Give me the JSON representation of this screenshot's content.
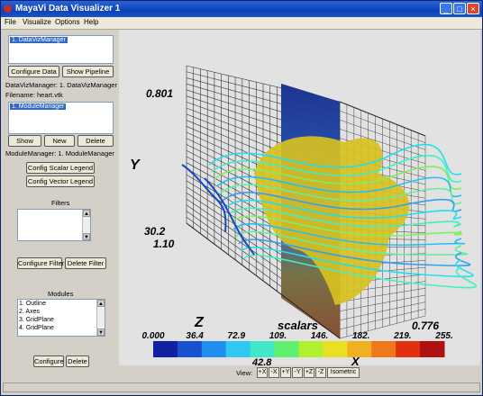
{
  "window": {
    "title": "MayaVi Data Visualizer 1",
    "minimize_glyph": "_",
    "maximize_glyph": "□",
    "close_glyph": "×"
  },
  "menu": [
    "File",
    "Visualize",
    "Options",
    "Help"
  ],
  "data_panel": {
    "list_items": [
      "1. DataVizManager"
    ],
    "configure_label": "Configure Data",
    "pipeline_label": "Show Pipeline",
    "manager_text": "DataVizManager: 1. DataVizManager",
    "filename_text": "Filename: heart.vtk"
  },
  "module_manager_panel": {
    "list_items": [
      "1. ModuleManager"
    ],
    "show_label": "Show",
    "new_label": "New",
    "delete_label": "Delete",
    "manager_text": "ModuleManager: 1. ModuleManager",
    "scalar_legend_label": "Config Scalar Legend",
    "vector_legend_label": "Config Vector Legend"
  },
  "filters_panel": {
    "heading": "Filters",
    "configure_label": "Configure Filter",
    "delete_label": "Delete Filter"
  },
  "modules_panel": {
    "heading": "Modules",
    "items": [
      "1. Outline",
      "2. Axes",
      "3. GridPlane",
      "4. GridPlane"
    ],
    "configure_label": "Configure",
    "delete_label": "Delete"
  },
  "scene": {
    "axis_y_top": "0.801",
    "axis_y_bottom": "30.2",
    "axis_y_low": "1.10",
    "axis_x_right": "0.776",
    "axis_z_bottom": "42.8",
    "y_letter": "Y",
    "z_letter": "Z",
    "x_letter": "X",
    "legend_title": "scalars",
    "legend_ticks": [
      "0.000",
      "36.4",
      "72.9",
      "109.",
      "146.",
      "182.",
      "219.",
      "255."
    ],
    "legend_colors": [
      "#1020a0",
      "#1850d0",
      "#2090f0",
      "#30c8f0",
      "#40e8c8",
      "#60f070",
      "#b0f030",
      "#e8e020",
      "#f0b020",
      "#f07818",
      "#e03010",
      "#b01010"
    ],
    "surface_color": "#d8c020"
  },
  "viewbar": {
    "label": "View:",
    "buttons": [
      "+X",
      "-X",
      "+Y",
      "-Y",
      "+Z",
      "-Z",
      "Isometric"
    ]
  }
}
